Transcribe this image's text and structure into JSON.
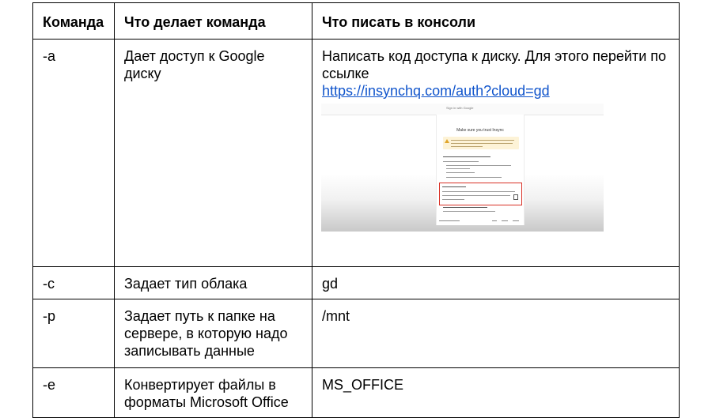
{
  "table": {
    "headers": [
      "Команда",
      "Что делает команда",
      "Что писать в консоли"
    ],
    "rows": [
      {
        "command": "-a",
        "description": "Дает доступ к Google диску",
        "console_text": "Написать код доступа к диску. Для этого перейти по ссылке",
        "console_link": "https://insynchq.com/auth?cloud=gd"
      },
      {
        "command": "-c",
        "description": "Задает тип облака",
        "console_text": "gd"
      },
      {
        "command": "-p",
        "description": "Задает путь к папке на сервере, в которую надо записывать данные",
        "console_text": "/mnt"
      },
      {
        "command": "-e",
        "description": "Конвертирует файлы в форматы Microsoft Office",
        "console_text": "MS_OFFICE"
      }
    ]
  },
  "screenshot": {
    "topbar_text": "Sign in with Google",
    "title": "Make sure you trust Insync",
    "highlight_color": "#d93025",
    "warning_icon": "warning-icon",
    "copy_icon": "copy-icon"
  }
}
